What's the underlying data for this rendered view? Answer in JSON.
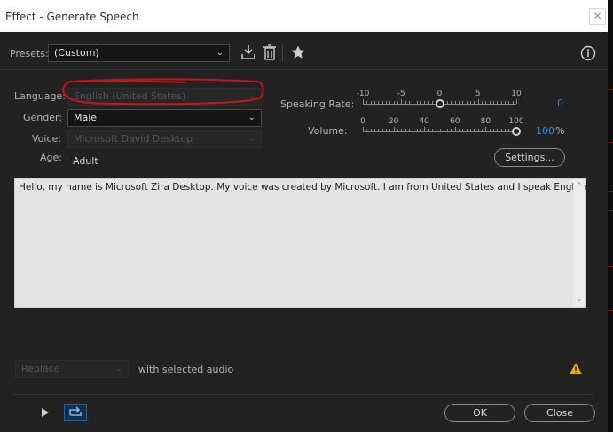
{
  "window": {
    "title": "Effect - Generate Speech"
  },
  "presets": {
    "label": "Presets:",
    "value": "(Custom)"
  },
  "language": {
    "label": "Language:",
    "value": "English (United States)"
  },
  "gender": {
    "label": "Gender:",
    "value": "Male"
  },
  "voice": {
    "label": "Voice:",
    "value": "Microsoft David Desktop"
  },
  "age": {
    "label": "Age:",
    "value": "Adult"
  },
  "speaking_rate": {
    "label": "Speaking Rate:",
    "value": "0",
    "ticks": [
      "-10",
      "-5",
      "0",
      "5",
      "10"
    ],
    "min": -10,
    "max": 10,
    "current": 0
  },
  "volume": {
    "label": "Volume:",
    "value": "100",
    "unit": "%",
    "ticks": [
      "0",
      "20",
      "40",
      "60",
      "80",
      "100"
    ],
    "min": 0,
    "max": 100,
    "current": 100
  },
  "settings_button": "Settings...",
  "text": "Hello, my name is Microsoft Zira Desktop. My voice was created by Microsoft. I am from United States and I speak English.",
  "mode": {
    "value": "Replace",
    "suffix": "with selected audio"
  },
  "ok_button": "OK",
  "close_button": "Close",
  "icons": {
    "save_preset": "download-icon",
    "delete_preset": "trash-icon",
    "favorite": "star-icon",
    "info": "info-icon",
    "warning": "warning-icon",
    "play": "play-icon",
    "loop": "loop-icon"
  },
  "colors": {
    "accent": "#2d8ceb",
    "annotation": "#c8141e",
    "warning": "#e8b400"
  }
}
